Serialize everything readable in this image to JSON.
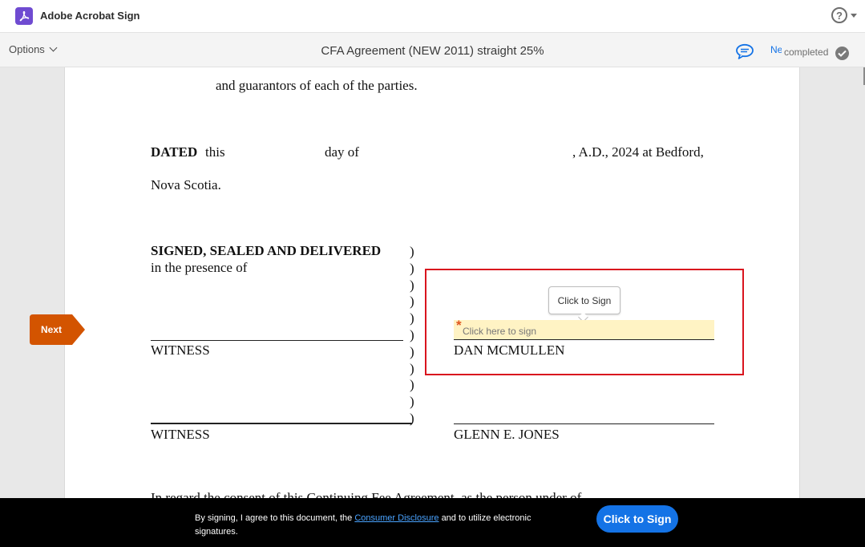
{
  "app": {
    "title": "Adobe Acrobat Sign",
    "help_symbol": "?",
    "logo_icon": "acrobat-logo-icon"
  },
  "toolbar": {
    "options_label": "Options",
    "document_title": "CFA Agreement (NEW 2011) straight 25%",
    "next_link": "Next",
    "status": "completed"
  },
  "document": {
    "line_guarantors": "and guarantors of each of the parties.",
    "dated_bold": "DATED",
    "dated_this": "this",
    "dated_day_of": "day of",
    "dated_year": ", A.D., 2024 at Bedford,",
    "dated_place": "Nova Scotia.",
    "signed_heading": "SIGNED, SEALED AND DELIVERED",
    "in_presence": "in the presence of",
    "witness_1": "WITNESS",
    "witness_2": "WITNESS",
    "signer_1": "DAN MCMULLEN",
    "signer_2": "GLENN E. JONES",
    "cutoff_line": "In regard the consent of this Continuing Fee Agreement, as the person under of"
  },
  "signature": {
    "tooltip": "Click to Sign",
    "required_mark": "*",
    "placeholder": "Click here to sign"
  },
  "nav": {
    "next_button": "Next"
  },
  "footer": {
    "consent_before": "By signing, I agree to this document, the",
    "consent_link": "Consumer Disclosure",
    "consent_after": "and to utilize electronic signatures.",
    "sign_button": "Click to Sign"
  },
  "colors": {
    "accent_blue": "#1473e6",
    "next_orange": "#d35400",
    "highlight_red": "#d9141e",
    "field_yellow": "#fff3c4"
  }
}
